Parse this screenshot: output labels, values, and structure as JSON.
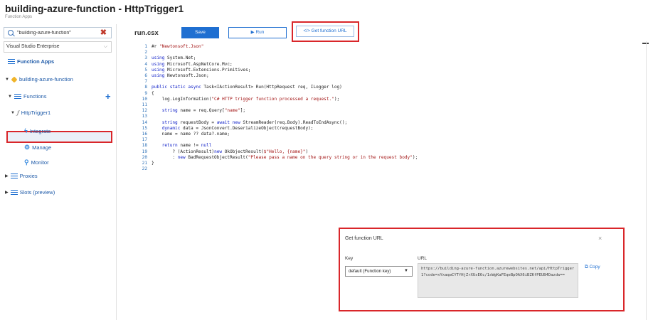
{
  "header": {
    "title": "building-azure-function - HttpTrigger1",
    "subtitle": "Function Apps"
  },
  "sidebar": {
    "search_value": "\"building-azure-function\"",
    "subscription": "Visual Studio Enterprise",
    "items": [
      {
        "label": "Function Apps"
      },
      {
        "label": "building-azure-function"
      },
      {
        "label": "Functions"
      },
      {
        "label": "HttpTrigger1"
      },
      {
        "label": "Integrate"
      },
      {
        "label": "Manage"
      },
      {
        "label": "Monitor"
      },
      {
        "label": "Proxies"
      },
      {
        "label": "Slots (preview)"
      }
    ]
  },
  "editor": {
    "filename": "run.csx",
    "save_label": "Save",
    "run_label": "Run",
    "get_url_label": "</> Get function URL",
    "lines": [
      {
        "n": "1",
        "text": "#r \"Newtonsoft.Json\""
      },
      {
        "n": "2",
        "text": ""
      },
      {
        "n": "3",
        "text": "using System.Net;"
      },
      {
        "n": "4",
        "text": "using Microsoft.AspNetCore.Mvc;"
      },
      {
        "n": "5",
        "text": "using Microsoft.Extensions.Primitives;"
      },
      {
        "n": "6",
        "text": "using Newtonsoft.Json;"
      },
      {
        "n": "7",
        "text": ""
      },
      {
        "n": "8",
        "text": "public static async Task<IActionResult> Run(HttpRequest req, ILogger log)"
      },
      {
        "n": "9",
        "text": "{"
      },
      {
        "n": "10",
        "text": "    log.LogInformation(\"C# HTTP trigger function processed a request.\");"
      },
      {
        "n": "11",
        "text": ""
      },
      {
        "n": "12",
        "text": "    string name = req.Query[\"name\"];"
      },
      {
        "n": "13",
        "text": ""
      },
      {
        "n": "14",
        "text": "    string requestBody = await new StreamReader(req.Body).ReadToEndAsync();"
      },
      {
        "n": "15",
        "text": "    dynamic data = JsonConvert.DeserializeObject(requestBody);"
      },
      {
        "n": "16",
        "text": "    name = name ?? data?.name;"
      },
      {
        "n": "17",
        "text": ""
      },
      {
        "n": "18",
        "text": "    return name != null"
      },
      {
        "n": "19",
        "text": "        ? (ActionResult)new OkObjectResult($\"Hello, {name}\")"
      },
      {
        "n": "20",
        "text": "        : new BadRequestObjectResult(\"Please pass a name on the query string or in the request body\");"
      },
      {
        "n": "21",
        "text": "}"
      },
      {
        "n": "22",
        "text": ""
      }
    ]
  },
  "popup": {
    "title": "Get function URL",
    "close": "×",
    "key_label": "Key",
    "key_value": "default (Function key)",
    "url_label": "URL",
    "url_value": "https://building-azure-function.azurewebsites.net/api/HttpTrigger1?code=xYxaqwCYTfHjZrXUsE6c/1sWgKaFEqeBpOAX6iBZKfPEUB4Dazdw==",
    "copy_label": "Copy"
  }
}
